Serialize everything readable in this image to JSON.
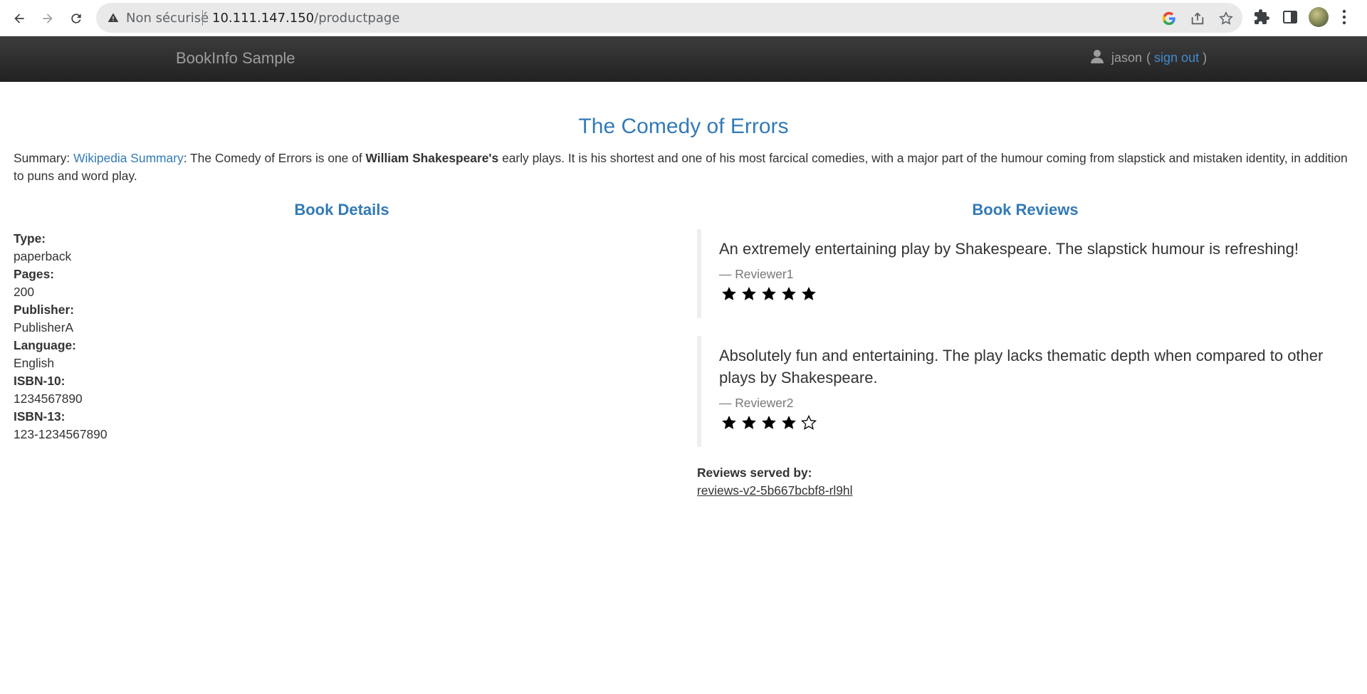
{
  "browser": {
    "insecure_label": "Non sécurisé",
    "url_host": "10.111.147.150",
    "url_path": "/productpage"
  },
  "navbar": {
    "brand": "BookInfo Sample",
    "user_name": "jason",
    "open_paren": "(",
    "sign_out": "sign out",
    "close_paren": ")"
  },
  "book": {
    "title": "The Comedy of Errors",
    "summary_label": "Summary:",
    "summary_link": "Wikipedia Summary",
    "summary_part1": ": The Comedy of Errors is one of",
    "summary_bold": "William Shakespeare's",
    "summary_part2": "early plays. It is his shortest and one of his most farcical comedies, with a major part of the humour coming from slapstick and mistaken identity, in addition to puns and word play."
  },
  "details": {
    "heading": "Book Details",
    "items": [
      {
        "label": "Type:",
        "value": "paperback"
      },
      {
        "label": "Pages:",
        "value": "200"
      },
      {
        "label": "Publisher:",
        "value": "PublisherA"
      },
      {
        "label": "Language:",
        "value": "English"
      },
      {
        "label": "ISBN-10:",
        "value": "1234567890"
      },
      {
        "label": "ISBN-13:",
        "value": "123-1234567890"
      }
    ]
  },
  "reviews": {
    "heading": "Book Reviews",
    "items": [
      {
        "text": "An extremely entertaining play by Shakespeare. The slapstick humour is refreshing!",
        "reviewer": "— Reviewer1",
        "rating": 5,
        "max": 5
      },
      {
        "text": "Absolutely fun and entertaining. The play lacks thematic depth when compared to other plays by Shakespeare.",
        "reviewer": "— Reviewer2",
        "rating": 4,
        "max": 5
      }
    ],
    "served_by_label": "Reviews served by:",
    "served_by_value": "reviews-v2-5b667bcbf8-rl9hl"
  }
}
